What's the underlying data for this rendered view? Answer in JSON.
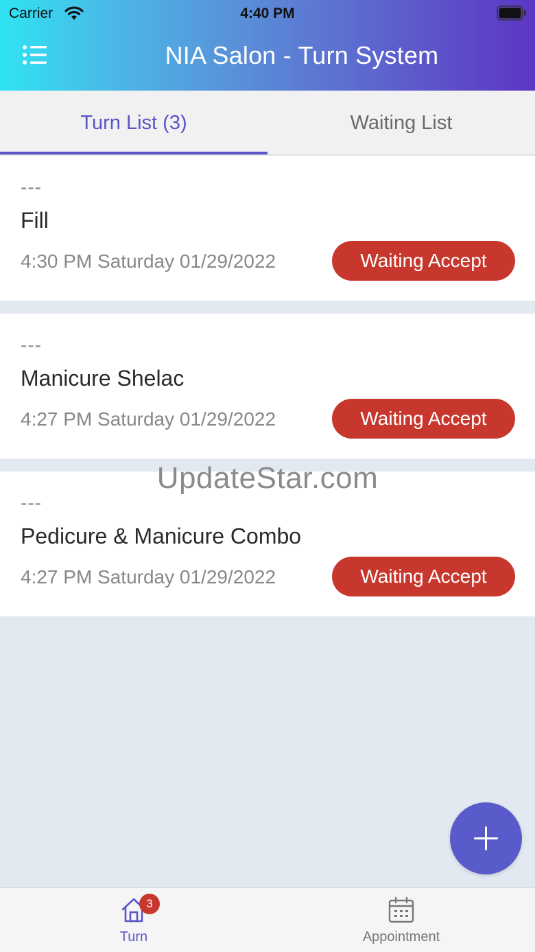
{
  "status_bar": {
    "carrier": "Carrier",
    "time": "4:40 PM"
  },
  "header": {
    "title": "NIA Salon - Turn System",
    "menu_icon": "list-menu-icon"
  },
  "tabs": [
    {
      "label": "Turn List (3)",
      "active": true
    },
    {
      "label": "Waiting List",
      "active": false
    }
  ],
  "turns": [
    {
      "dashes": "---",
      "service": "Fill",
      "time": "4:30 PM Saturday 01/29/2022",
      "status": "Waiting Accept"
    },
    {
      "dashes": "---",
      "service": "Manicure Shelac",
      "time": "4:27 PM Saturday 01/29/2022",
      "status": "Waiting Accept"
    },
    {
      "dashes": "---",
      "service": "Pedicure & Manicure Combo",
      "time": "4:27 PM Saturday 01/29/2022",
      "status": "Waiting Accept"
    }
  ],
  "watermark": "UpdateStar.com",
  "fab": {
    "icon": "plus-icon"
  },
  "bottom_nav": [
    {
      "label": "Turn",
      "icon": "home-icon",
      "badge": "3",
      "active": true
    },
    {
      "label": "Appointment",
      "icon": "calendar-icon",
      "active": false
    }
  ],
  "colors": {
    "accent": "#5a55c9",
    "status_red": "#c7372d",
    "header_gradient_start": "#2fe3f3",
    "header_gradient_end": "#5c36c4",
    "background": "#e3e9f1"
  }
}
